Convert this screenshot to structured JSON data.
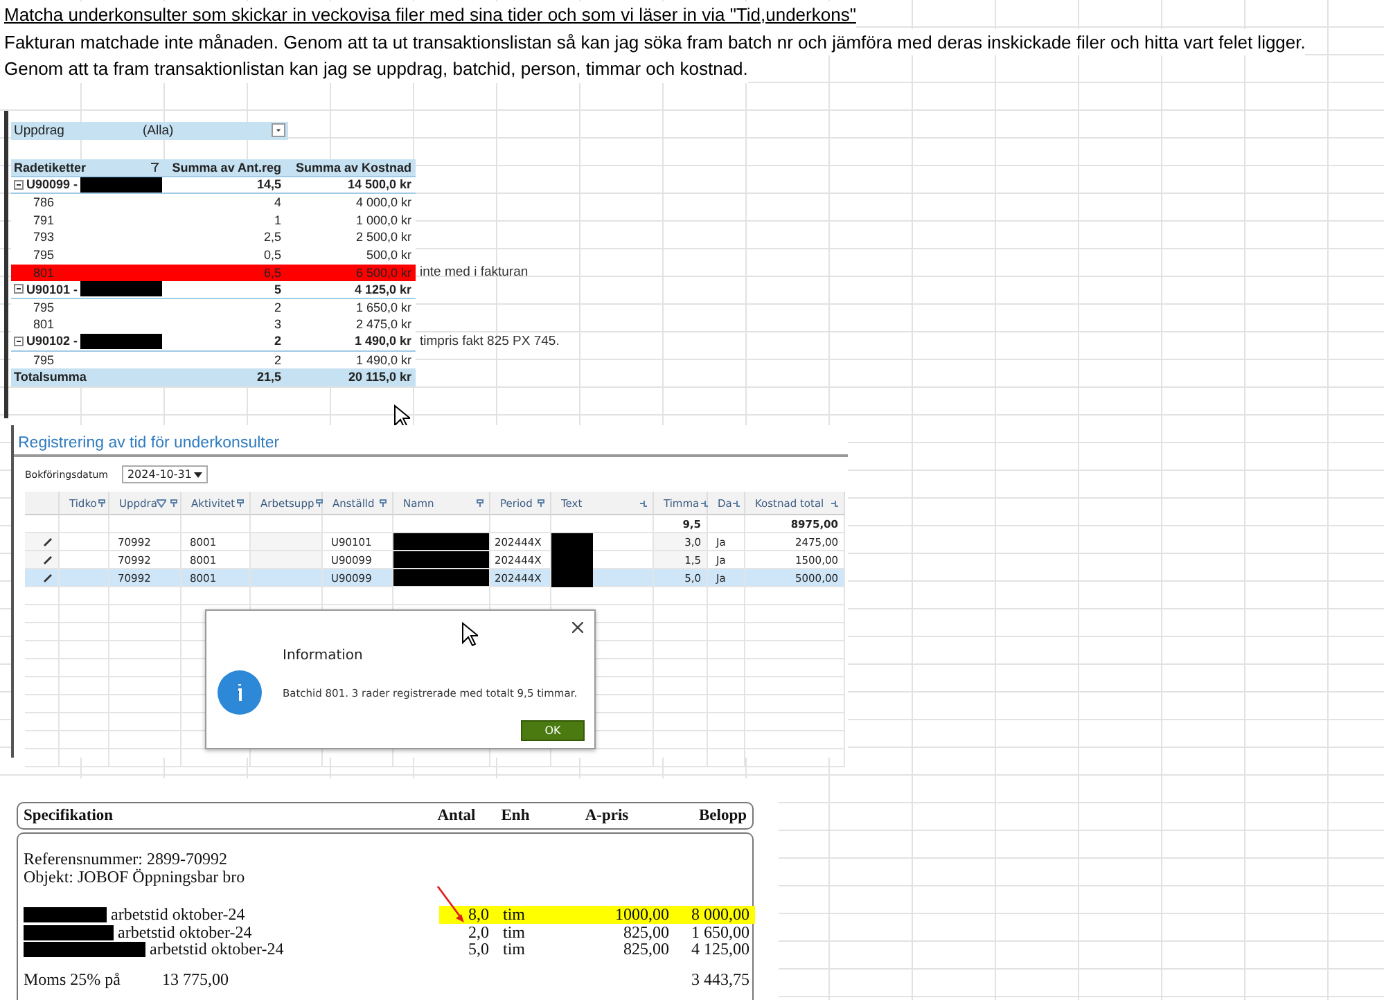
{
  "notes": [
    {
      "text": "Matcha underkonsulter som skickar  in veckovisa filer med sina tider  och som vi läser in  via \"Tid,underkons\"",
      "underlined": true
    },
    {
      "text": " Fakturan matchade inte månaden.  Genom att ta ut transaktionslistan så kan jag söka fram batch nr och jämföra med deras inskickade filer och hitta vart felet ligger.",
      "underlined": false
    },
    {
      "text": "Genom att ta fram transaktionlistan kan jag se uppdrag, batchid, person, timmar och kostnad.",
      "underlined": false
    }
  ],
  "pivot": {
    "filter": {
      "label": "Uppdrag",
      "value": "(Alla)"
    },
    "columns": [
      "Radetiketter",
      "Summa av Ant.reg",
      "Summa av Kostnad"
    ],
    "groups": [
      {
        "label": "U90099 -",
        "count": "14,5",
        "cost": "14 500,0 kr",
        "children": [
          {
            "label": "786",
            "count": "4",
            "cost": "4 000,0 kr",
            "highlighted": false
          },
          {
            "label": "791",
            "count": "1",
            "cost": "1 000,0 kr",
            "highlighted": false
          },
          {
            "label": "793",
            "count": "2,5",
            "cost": "2 500,0 kr",
            "highlighted": false
          },
          {
            "label": "795",
            "count": "0,5",
            "cost": "500,0 kr",
            "highlighted": false
          },
          {
            "label": "801",
            "count": "6,5",
            "cost": "6 500,0 kr",
            "highlighted": true,
            "note": "inte med i fakturan"
          }
        ]
      },
      {
        "label": "U90101 -",
        "count": "5",
        "cost": "4 125,0 kr",
        "children": [
          {
            "label": "795",
            "count": "2",
            "cost": "1 650,0 kr",
            "highlighted": false
          },
          {
            "label": "801",
            "count": "3",
            "cost": "2 475,0 kr",
            "highlighted": false
          }
        ]
      },
      {
        "label": "U90102 -",
        "count": "2",
        "cost": "1 490,0 kr",
        "note": "timpris fakt 825 PX 745.",
        "children": [
          {
            "label": "795",
            "count": "2",
            "cost": "1 490,0 kr",
            "highlighted": false
          }
        ]
      }
    ],
    "total": {
      "label": "Totalsumma",
      "count": "21,5",
      "cost": "20 115,0 kr"
    }
  },
  "registration": {
    "title": "Registrering av tid för underkonsulter",
    "date_label": "Bokföringsdatum",
    "date_value": "2024-10-31",
    "columns": [
      {
        "label": "Tidko",
        "filtered": false
      },
      {
        "label": "Uppdra",
        "filtered": true
      },
      {
        "label": "Aktivitet",
        "filtered": false
      },
      {
        "label": "Arbetsupp",
        "filtered": false
      },
      {
        "label": "Anställd",
        "filtered": false
      },
      {
        "label": "Namn",
        "filtered": false
      },
      {
        "label": "Period",
        "filtered": false
      },
      {
        "label": "Text",
        "filtered": false
      },
      {
        "label": "Timma",
        "filtered": false
      },
      {
        "label": "Da",
        "filtered": false
      },
      {
        "label": "Kostnad total",
        "filtered": false
      }
    ],
    "summary": {
      "hours": "9,5",
      "cost": "8975,00"
    },
    "rows": [
      {
        "uppdrag": "70992",
        "aktivitet": "8001",
        "anstalld": "U90101",
        "period": "202444X",
        "timma": "3,0",
        "da": "Ja",
        "kostnad": "2475,00",
        "selected": false
      },
      {
        "uppdrag": "70992",
        "aktivitet": "8001",
        "anstalld": "U90099",
        "period": "202444X",
        "timma": "1,5",
        "da": "Ja",
        "kostnad": "1500,00",
        "selected": false
      },
      {
        "uppdrag": "70992",
        "aktivitet": "8001",
        "anstalld": "U90099",
        "period": "202444X",
        "timma": "5,0",
        "da": "Ja",
        "kostnad": "5000,00",
        "selected": true
      }
    ],
    "dialog": {
      "title": "Information",
      "message": "Batchid 801. 3 rader registrerade med totalt 9,5 timmar.",
      "button": "OK"
    }
  },
  "invoice": {
    "columns": [
      "Specifikation",
      "Antal",
      "Enh",
      "A-pris",
      "Belopp"
    ],
    "info": [
      "Referensnummer: 2899-70992",
      "Objekt: JOBOF Öppningsbar bro"
    ],
    "lines": [
      {
        "description": "arbetstid oktober-24",
        "antal": "8,0",
        "enh": "tim",
        "apris": "1000,00",
        "belopp": "8 000,00",
        "highlighted": true
      },
      {
        "description": "arbetstid oktober-24",
        "antal": "2,0",
        "enh": "tim",
        "apris": "825,00",
        "belopp": "1 650,00",
        "highlighted": false
      },
      {
        "description": "arbetstid oktober-24",
        "antal": "5,0",
        "enh": "tim",
        "apris": "825,00",
        "belopp": "4 125,00",
        "highlighted": false
      }
    ],
    "moms": {
      "label": "Moms 25% på",
      "base": "13 775,00",
      "amount": "3 443,75"
    }
  }
}
